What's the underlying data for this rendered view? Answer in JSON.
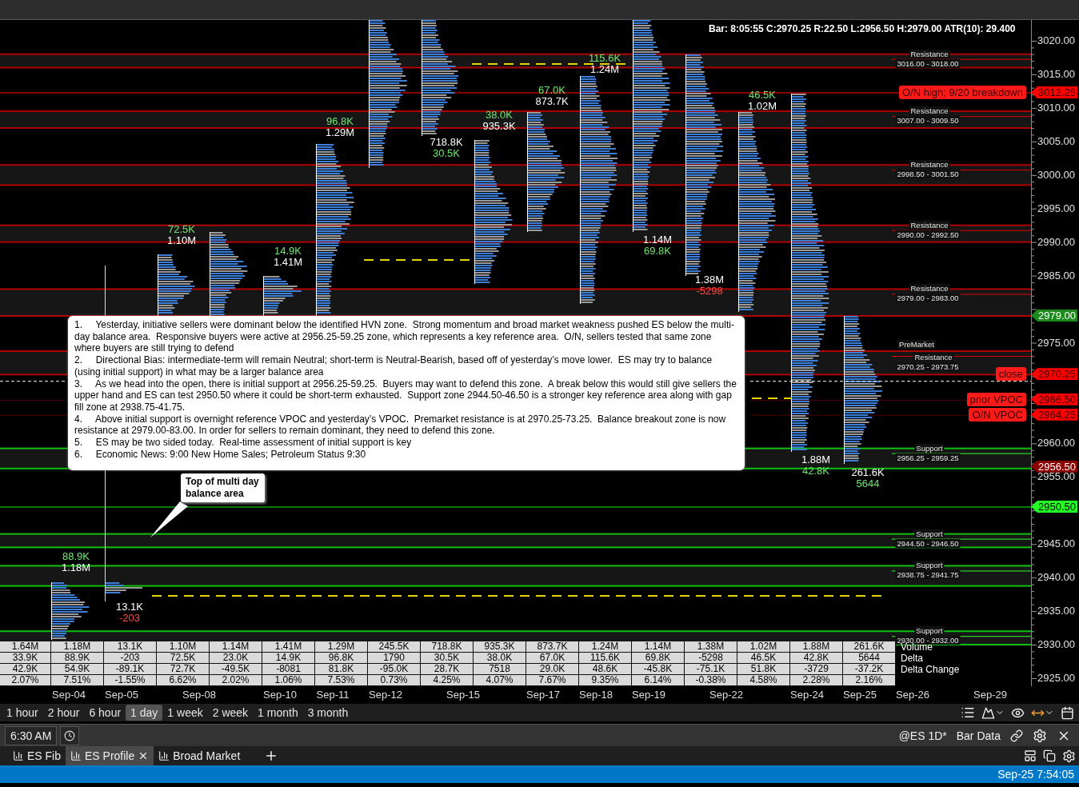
{
  "header": {
    "bar_info": "Bar: 8:05:55  C:2970.25  R:22.50  L:2956.50  H:2979.00  ATR(10): 29.400"
  },
  "price_axis": [
    "3020.00",
    "3015.00",
    "3010.00",
    "3005.00",
    "3000.00",
    "2995.00",
    "2990.00",
    "2985.00",
    "2975.00",
    "2960.00",
    "2955.00",
    "2945.00",
    "2940.00",
    "2935.00",
    "2930.00",
    "2925.00"
  ],
  "zones": [
    {
      "kind": "resistance",
      "title": "Resistance",
      "range": "3016.00 - 3018.00"
    },
    {
      "kind": "resistance",
      "title": "Resistance",
      "range": "3007.00 - 3009.50"
    },
    {
      "kind": "resistance",
      "title": "Resistance",
      "range": "2998.50 - 3001.50"
    },
    {
      "kind": "resistance",
      "title": "Resistance",
      "range": "2990.00 - 2992.50"
    },
    {
      "kind": "resistance",
      "title": "Resistance",
      "range": "2979.00 - 2983.00"
    },
    {
      "kind": "resistance",
      "title": "Resistance",
      "range": "2970.25 - 2973.75",
      "pre_label": "PreMarket"
    },
    {
      "kind": "support",
      "title": "Support",
      "range": "2956.25 - 2959.25"
    },
    {
      "kind": "support",
      "title": "Support",
      "range": "2944.50 - 2946.50"
    },
    {
      "kind": "support",
      "title": "Support",
      "range": "2938.75 - 2941.75"
    },
    {
      "kind": "support",
      "title": "Support",
      "range": "2930.00 - 2932.00"
    }
  ],
  "price_tags": [
    {
      "kind": "alert",
      "text": "3012.25",
      "note": "O/N high; 9/20 breakdown"
    },
    {
      "kind": "high",
      "text": "2979.00"
    },
    {
      "kind": "alert",
      "text": "2970.25",
      "note": "close"
    },
    {
      "kind": "alert",
      "text": "2966.50",
      "note": "prior VPOC"
    },
    {
      "kind": "alert",
      "text": "2964.25",
      "note": "O/N VPOC"
    },
    {
      "kind": "low",
      "text": "2956.50"
    },
    {
      "kind": "target",
      "text": "2950.50"
    }
  ],
  "day_labels": [
    {
      "lines": [
        {
          "kind": "gain",
          "text": "88.9K"
        },
        {
          "kind": "volume",
          "text": "1.18M"
        }
      ]
    },
    {
      "lines": [
        {
          "kind": "volume",
          "text": "13.1K"
        },
        {
          "kind": "loss",
          "text": "-203"
        }
      ]
    },
    {
      "lines": [
        {
          "kind": "gain",
          "text": "72.5K"
        },
        {
          "kind": "volume",
          "text": "1.10M"
        }
      ]
    },
    {
      "lines": [
        {
          "kind": "gain",
          "text": "14.9K"
        },
        {
          "kind": "volume",
          "text": "1.41M"
        }
      ]
    },
    {
      "lines": [
        {
          "kind": "gain",
          "text": "96.8K"
        },
        {
          "kind": "volume",
          "text": "1.29M"
        }
      ]
    },
    {
      "lines": [
        {
          "kind": "volume",
          "text": "718.8K"
        },
        {
          "kind": "gain",
          "text": "30.5K"
        }
      ]
    },
    {
      "lines": [
        {
          "kind": "gain",
          "text": "38.0K"
        },
        {
          "kind": "volume",
          "text": "935.3K"
        }
      ]
    },
    {
      "lines": [
        {
          "kind": "gain",
          "text": "67.0K"
        },
        {
          "kind": "volume",
          "text": "873.7K"
        }
      ]
    },
    {
      "lines": [
        {
          "kind": "gain",
          "text": "115.6K"
        },
        {
          "kind": "volume",
          "text": "1.24M"
        }
      ]
    },
    {
      "lines": [
        {
          "kind": "volume",
          "text": "1.14M"
        },
        {
          "kind": "gain",
          "text": "69.8K"
        }
      ]
    },
    {
      "lines": [
        {
          "kind": "volume",
          "text": "1.38M"
        },
        {
          "kind": "loss",
          "text": "-5298"
        }
      ]
    },
    {
      "lines": [
        {
          "kind": "gain",
          "text": "46.5K"
        },
        {
          "kind": "volume",
          "text": "1.02M"
        }
      ]
    },
    {
      "lines": [
        {
          "kind": "volume",
          "text": "1.88M"
        },
        {
          "kind": "gain",
          "text": "42.8K"
        }
      ]
    },
    {
      "lines": [
        {
          "kind": "volume",
          "text": "261.6K"
        },
        {
          "kind": "gain",
          "text": "5644"
        }
      ]
    }
  ],
  "notes": [
    "1.     Yesterday, initiative sellers were dominant below the identified HVN zone.  Strong momentum and broad market weakness pushed ES below the multi-day balance area.  Responsive buyers were active at 2956.25-59.25 zone, which represents a key reference area.  O/N, sellers tested that same zone where buyers are still trying to defend",
    "2.     Directional Bias: intermediate-term will remain Neutral; short-term is Neutral-Bearish, based off of yesterday’s move lower.  ES may try to balance (using initial support) in what may be a larger balance area",
    "3.     As we head into the open, there is initial support at 2956.25-59.25.  Buyers may want to defend this zone.  A break below this would still give sellers the upper hand and ES can test 2950.50 where it could be short-term exhausted.  Support zone 2944.50-46.50 is a stronger key reference area along with gap fill zone at 2938.75-41.75.",
    "4.     Above initial support is overnight reference VPOC and yesterday’s VPOC.  Premarket resistance is at 2970.25-73.25.  Balance breakout zone is now resistance at 2979.00-83.00. In order for sellers to remain dominant, they need to defend this zone.",
    "5.     ES may be two sided today.  Real-time assessment of initial support is key",
    "6.     Economic News: 9:00 New Home Sales; Petroleum Status 9:30"
  ],
  "callout": "Top of multi day balance area",
  "stats_table": {
    "rows": [
      {
        "label": "Volume",
        "cells": [
          "1.64M",
          "1.18M",
          "13.1K",
          "1.10M",
          "1.14M",
          "1.41M",
          "1.29M",
          "245.5K",
          "718.8K",
          "935.3K",
          "873.7K",
          "1.24M",
          "1.14M",
          "1.38M",
          "1.02M",
          "1.88M",
          "261.6K"
        ]
      },
      {
        "label": "Delta",
        "cells": [
          "33.9K",
          "88.9K",
          "-203",
          "72.5K",
          "23.0K",
          "14.9K",
          "96.8K",
          "1790",
          "30.5K",
          "38.0K",
          "67.0K",
          "115.6K",
          "69.8K",
          "-5298",
          "46.5K",
          "42.8K",
          "5644"
        ]
      },
      {
        "label": "Delta Change",
        "cells": [
          "42.9K",
          "54.9K",
          "-89.1K",
          "72.7K",
          "-49.5K",
          "-8081",
          "81.8K",
          "-95.0K",
          "28.7K",
          "7518",
          "29.0K",
          "48.6K",
          "-45.8K",
          "-75.1K",
          "51.8K",
          "-3729",
          "-37.2K"
        ]
      },
      {
        "cells": [
          "2.07%",
          "7.51%",
          "-1.55%",
          "6.62%",
          "2.02%",
          "1.06%",
          "7.53%",
          "0.73%",
          "4.25%",
          "4.07%",
          "7.67%",
          "9.35%",
          "6.14%",
          "-0.38%",
          "4.58%",
          "2.28%",
          "2.16%"
        ]
      }
    ]
  },
  "date_axis": [
    "Sep-04",
    "Sep-05",
    "Sep-08",
    "Sep-10",
    "Sep-11",
    "Sep-12",
    "Sep-15",
    "Sep-17",
    "Sep-18",
    "Sep-19",
    "Sep-22",
    "Sep-24",
    "Sep-25",
    "Sep-26",
    "Sep-29"
  ],
  "timeframes": [
    {
      "label": "1 hour",
      "selected": false
    },
    {
      "label": "2 hour",
      "selected": false
    },
    {
      "label": "6 hour",
      "selected": false
    },
    {
      "label": "1 day",
      "selected": true
    },
    {
      "label": "1 week",
      "selected": false
    },
    {
      "label": "2 week",
      "selected": false
    },
    {
      "label": "1 month",
      "selected": false
    },
    {
      "label": "3 month",
      "selected": false
    }
  ],
  "toolbar": {
    "time": "6:30 AM",
    "symbol": "@ES 1D*",
    "data_label": "Bar Data"
  },
  "tabs": [
    {
      "label": "ES Fib",
      "selected": false
    },
    {
      "label": "ES Profile",
      "selected": true
    },
    {
      "label": "Broad Market",
      "selected": false
    }
  ],
  "status_bar": {
    "datetime": "Sep-25 7:54:05"
  }
}
